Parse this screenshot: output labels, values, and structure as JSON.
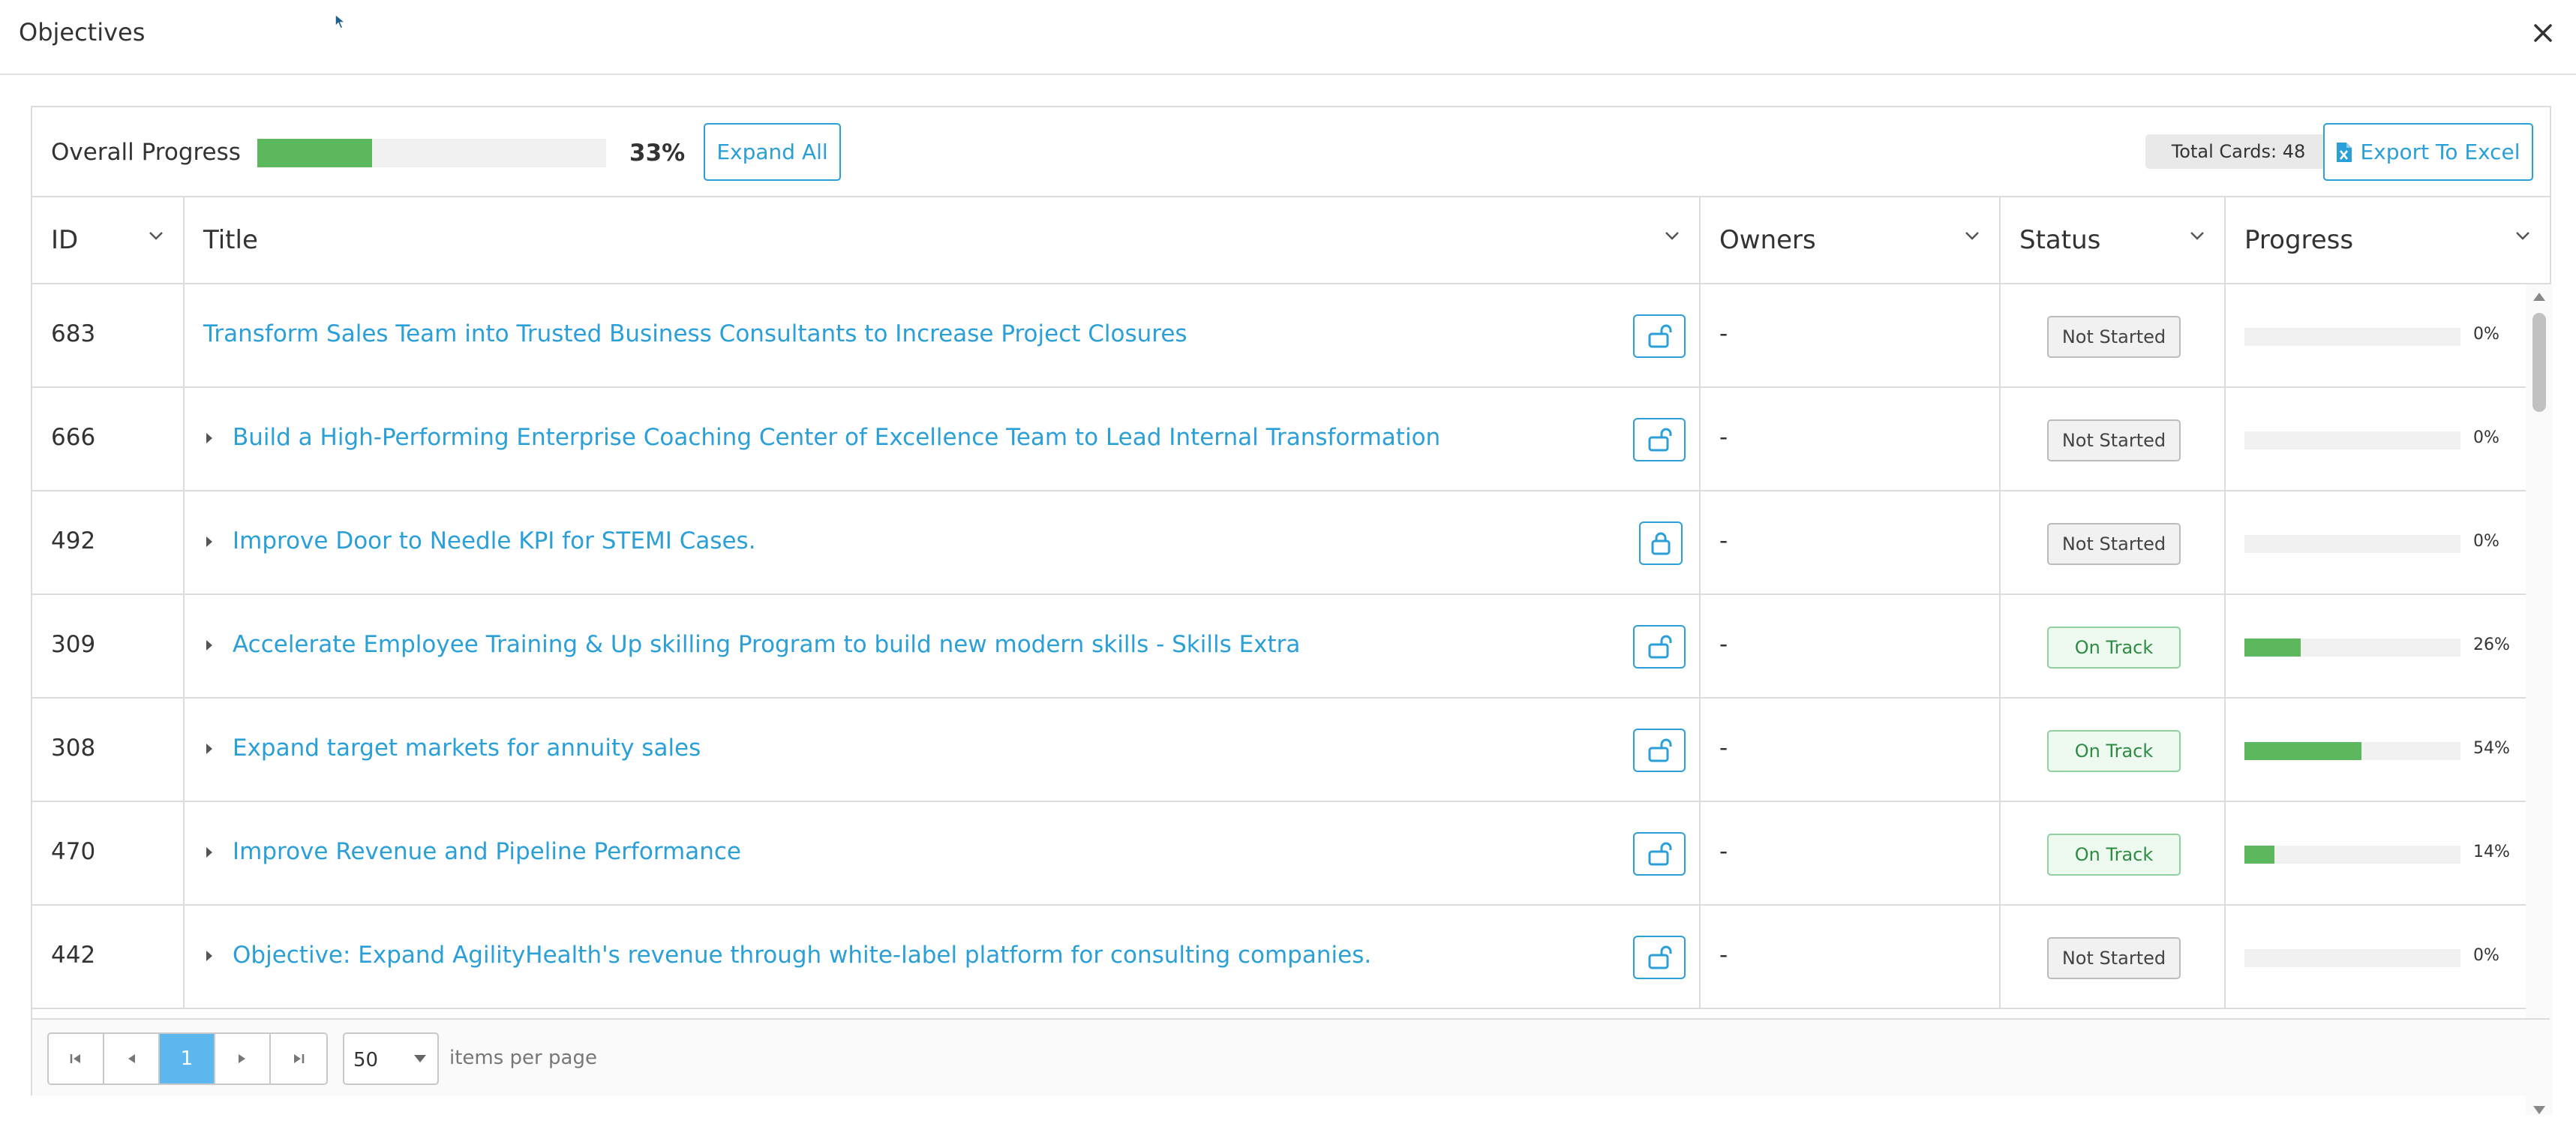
{
  "dialog": {
    "title": "Objectives",
    "close_label": "✕"
  },
  "toolbar": {
    "overall_label": "Overall Progress",
    "overall_percent": "33%",
    "overall_fraction": 0.33,
    "expand_label": "Expand All",
    "total_cards": "Total Cards: 48",
    "export_label": "Export To Excel"
  },
  "columns": {
    "id": "ID",
    "title": "Title",
    "owners": "Owners",
    "status": "Status",
    "progress": "Progress"
  },
  "rows": [
    {
      "id": "683",
      "title": "Transform Sales Team into Trusted Business Consultants to Increase Project Closures",
      "expandable": false,
      "lock": "unlocked",
      "owners": "-",
      "status": "Not Started",
      "status_type": "notstarted",
      "progress_label": "0%",
      "progress": 0
    },
    {
      "id": "666",
      "title": "Build a High-Performing Enterprise Coaching Center of Excellence Team to Lead Internal Transformation",
      "expandable": true,
      "lock": "unlocked",
      "owners": "-",
      "status": "Not Started",
      "status_type": "notstarted",
      "progress_label": "0%",
      "progress": 0
    },
    {
      "id": "492",
      "title": "Improve Door to Needle KPI for STEMI Cases.",
      "expandable": true,
      "lock": "locked",
      "owners": "-",
      "status": "Not Started",
      "status_type": "notstarted",
      "progress_label": "0%",
      "progress": 0
    },
    {
      "id": "309",
      "title": "Accelerate Employee Training & Up skilling Program to build new modern skills - Skills Extra",
      "expandable": true,
      "lock": "unlocked",
      "owners": "-",
      "status": "On Track",
      "status_type": "ontrack",
      "progress_label": "26%",
      "progress": 0.26
    },
    {
      "id": "308",
      "title": "Expand target markets for annuity sales",
      "expandable": true,
      "lock": "unlocked",
      "owners": "-",
      "status": "On Track",
      "status_type": "ontrack",
      "progress_label": "54%",
      "progress": 0.54
    },
    {
      "id": "470",
      "title": "Improve Revenue and Pipeline Performance",
      "expandable": true,
      "lock": "unlocked",
      "owners": "-",
      "status": "On Track",
      "status_type": "ontrack",
      "progress_label": "14%",
      "progress": 0.14
    },
    {
      "id": "442",
      "title": "Objective: Expand AgilityHealth's revenue through white-label platform for consulting companies.",
      "expandable": true,
      "lock": "unlocked",
      "owners": "-",
      "status": "Not Started",
      "status_type": "notstarted",
      "progress_label": "0%",
      "progress": 0
    }
  ],
  "pager": {
    "current_page": "1",
    "page_size": "50",
    "items_label": "items per page"
  },
  "colors": {
    "accent": "#2a9fd8",
    "progress": "#5cb85c",
    "current_page": "#5db8ef"
  }
}
